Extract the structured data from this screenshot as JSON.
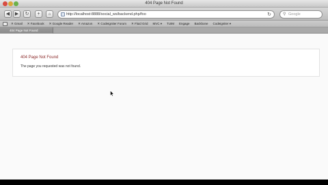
{
  "window": {
    "title": "404 Page Not Found"
  },
  "toolbar": {
    "back_glyph": "◀",
    "forward_glyph": "▶",
    "add_glyph": "+",
    "reload_glyph": "↻",
    "url": "http://localhost:8888/social_ws/backend.php/foo",
    "search_placeholder": "Google"
  },
  "bookmarks": {
    "items": [
      "✕ Gmail",
      "✕ Facebook",
      "✕ Google Reader",
      "✕ Amazon",
      "✕ CodeIgniter Forum",
      "✕ Fluid Grid",
      "MVC ▾",
      "TUIM",
      "Engage",
      "Backbone",
      "Codeigniter ▾"
    ]
  },
  "tab": {
    "label": "404 Page Not Found"
  },
  "page": {
    "heading": "404 Page Not Found",
    "message": "The page you requested was not found."
  },
  "icons": {
    "cursor": "arrow-pointer-icon",
    "url": "page-icon",
    "search": "magnifier-icon"
  }
}
